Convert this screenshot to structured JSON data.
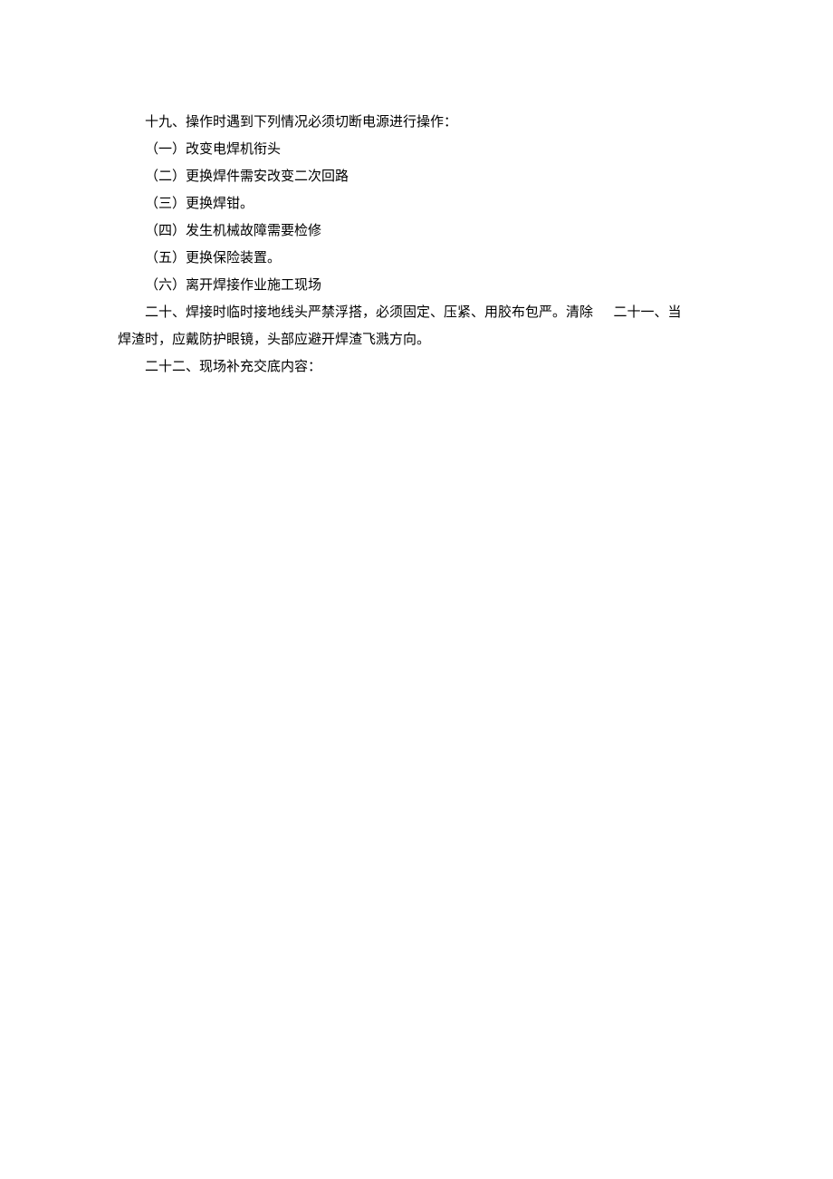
{
  "paragraphs": {
    "p19": "十九、操作时遇到下列情况必须切断电源进行操作：",
    "p19_items": [
      "（一）改变电焊机衔头",
      "（二）更换焊件需安改变二次回路",
      "（三）更换焊钳。",
      "（四）发生机械故障需要检修",
      "（五）更换保险装置。",
      "（六）离开焊接作业施工现场"
    ],
    "p20_part1": "二十、焊接时临时接地线头严禁浮搭，必须固定、压紧、用胶布包严。清除",
    "p20_part2": "二十一、当",
    "p20_cont": "焊渣时，应戴防护眼镜，头部应避开焊渣飞溅方向。",
    "p22": "二十二、现场补充交底内容："
  }
}
